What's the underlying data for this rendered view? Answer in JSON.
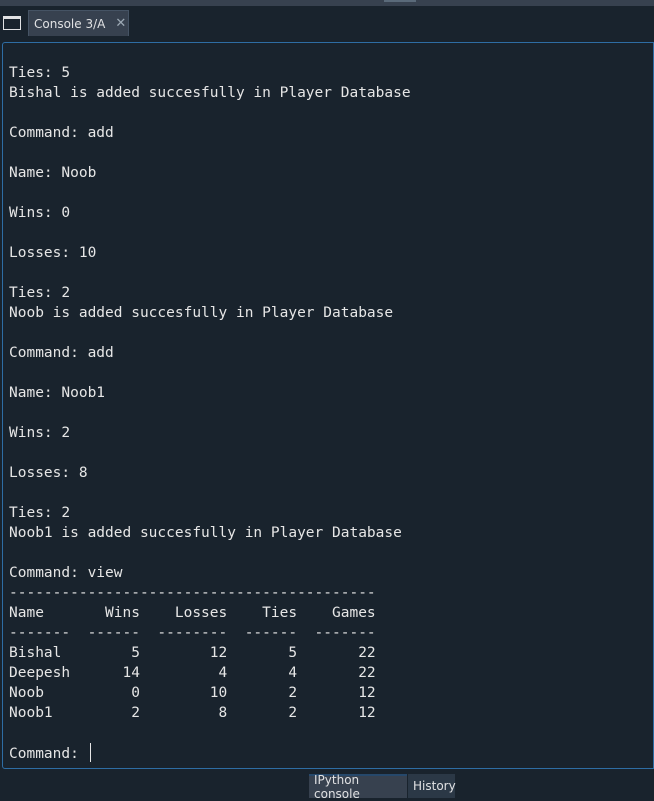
{
  "tabs": {
    "console_tab_label": "Console 3/A",
    "close_glyph": "✕"
  },
  "console": {
    "lines": [
      "Ties: 5",
      "Bishal is added succesfully in Player Database",
      "",
      "Command: add",
      "",
      "Name: Noob",
      "",
      "Wins: 0",
      "",
      "Losses: 10",
      "",
      "Ties: 2",
      "Noob is added succesfully in Player Database",
      "",
      "Command: add",
      "",
      "Name: Noob1",
      "",
      "Wins: 2",
      "",
      "Losses: 8",
      "",
      "Ties: 2",
      "Noob1 is added succesfully in Player Database",
      "",
      "Command: view",
      "------------------------------------------",
      "Name       Wins    Losses    Ties    Games",
      "-------  ------  --------  ------  -------",
      "Bishal        5        12       5       22",
      "Deepesh      14         4       4       22",
      "Noob          0        10       2       12",
      "Noob1         2         8       2       12",
      ""
    ],
    "prompt": "Command: "
  },
  "bottom_tabs": {
    "ipython_label": "IPython console",
    "history_label": "History"
  },
  "colors": {
    "background": "#19232d",
    "console_border": "#2e6da4",
    "text": "#e6e6e6",
    "tab_bg": "#37414f"
  }
}
